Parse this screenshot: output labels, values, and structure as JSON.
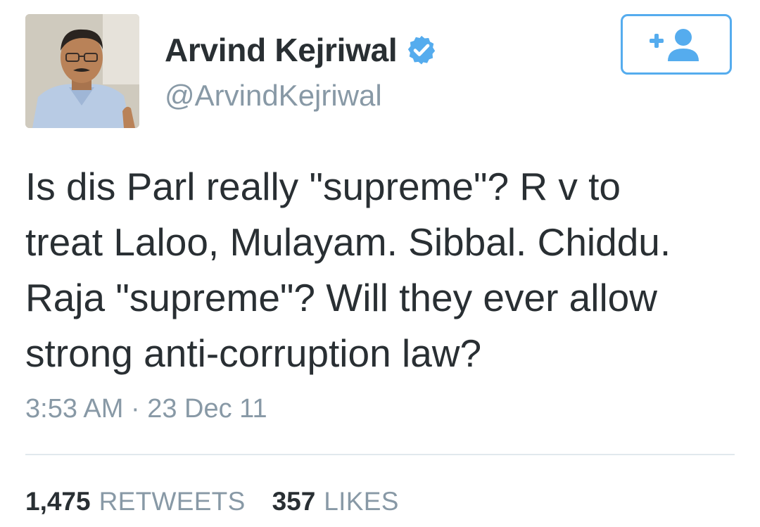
{
  "user": {
    "display_name": "Arvind Kejriwal",
    "handle": "@ArvindKejriwal",
    "verified": true,
    "avatar_icon": "profile-photo"
  },
  "follow_button": {
    "icon": "follow-user-icon",
    "color": "#55acee"
  },
  "tweet": {
    "lines": [
      "Is dis Parl really \"supreme\"? R v to",
      "treat Laloo, Mulayam. Sibbal. Chiddu.",
      "Raja \"supreme\"? Will they ever allow",
      "strong anti-corruption law?"
    ],
    "timestamp": "3:53 AM · 23 Dec 11"
  },
  "stats": {
    "retweets_count": "1,475",
    "retweets_label": "RETWEETS",
    "likes_count": "357",
    "likes_label": "LIKES"
  },
  "colors": {
    "text": "#292f33",
    "muted": "#8899a6",
    "accent": "#55acee",
    "divider": "#e1e8ed"
  }
}
